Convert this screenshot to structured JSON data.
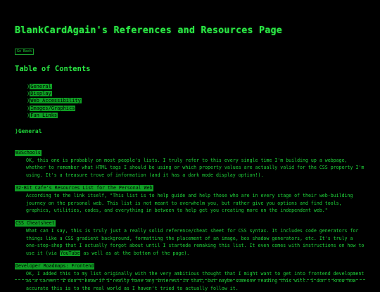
{
  "page": {
    "title": "BlankCardAgain's References and Resources Page",
    "back_label": "Go Back"
  },
  "toc": {
    "heading": "Table of Contents",
    "arrow": "⟩",
    "items": [
      {
        "label": "General"
      },
      {
        "label": "Display"
      },
      {
        "label": "Web Accessibility"
      },
      {
        "label": "Images/Graphics"
      },
      {
        "label": "Fun Links"
      }
    ]
  },
  "general": {
    "heading": "⟩General",
    "entries": [
      {
        "title": "W3Schools",
        "desc": "OK, this one is probably on most people's lists. I truly refer to this every single time I'm building up a webpage, whether to remember what HTML tags I should be using or which property values are actually valid for the CSS property I'm using. It's a treasure trove of information (and it has a dark mode display option!)."
      },
      {
        "title": "32-Bit Cafe's Resources List for the Personal Web",
        "desc": "According to the link itself, \"This list is to help guide and help those who are in every stage of their web-building journey on the personal web. This list is not meant to overwhelm you, but rather give you options and find tools, graphics, utilities, codes, and everything in between to help get you creating more on the independent web.\""
      },
      {
        "title": "CSS Cheatsheet",
        "desc_before": "What can I say, this is truly just a really solid reference/cheat sheet for CSS syntax. It includes code generators for things like a CSS gradient background, formatting the placement of an image, box shadow generators, etc. It's truly a one-stop-shop that I actually forgot about until I startede remaking this list. It even comes with instructions on how to use it (via ",
        "desc_link": "YouTube",
        "desc_after": " as well as at the bottom of the page)."
      },
      {
        "title": "Developer Roadmaps: Frontend",
        "desc": "OK, I added this to my list originally with the very ambitious thought that I might want to get into frontend development as a career. I don't know if I really have any interest in that, but maybe someone reading this will. I don't know how accurate this is to the real world as I haven't tried to actually follow it."
      }
    ]
  },
  "colors": {
    "background": "#000000",
    "text": "#1fd43a",
    "highlight": "#0f9f24"
  }
}
